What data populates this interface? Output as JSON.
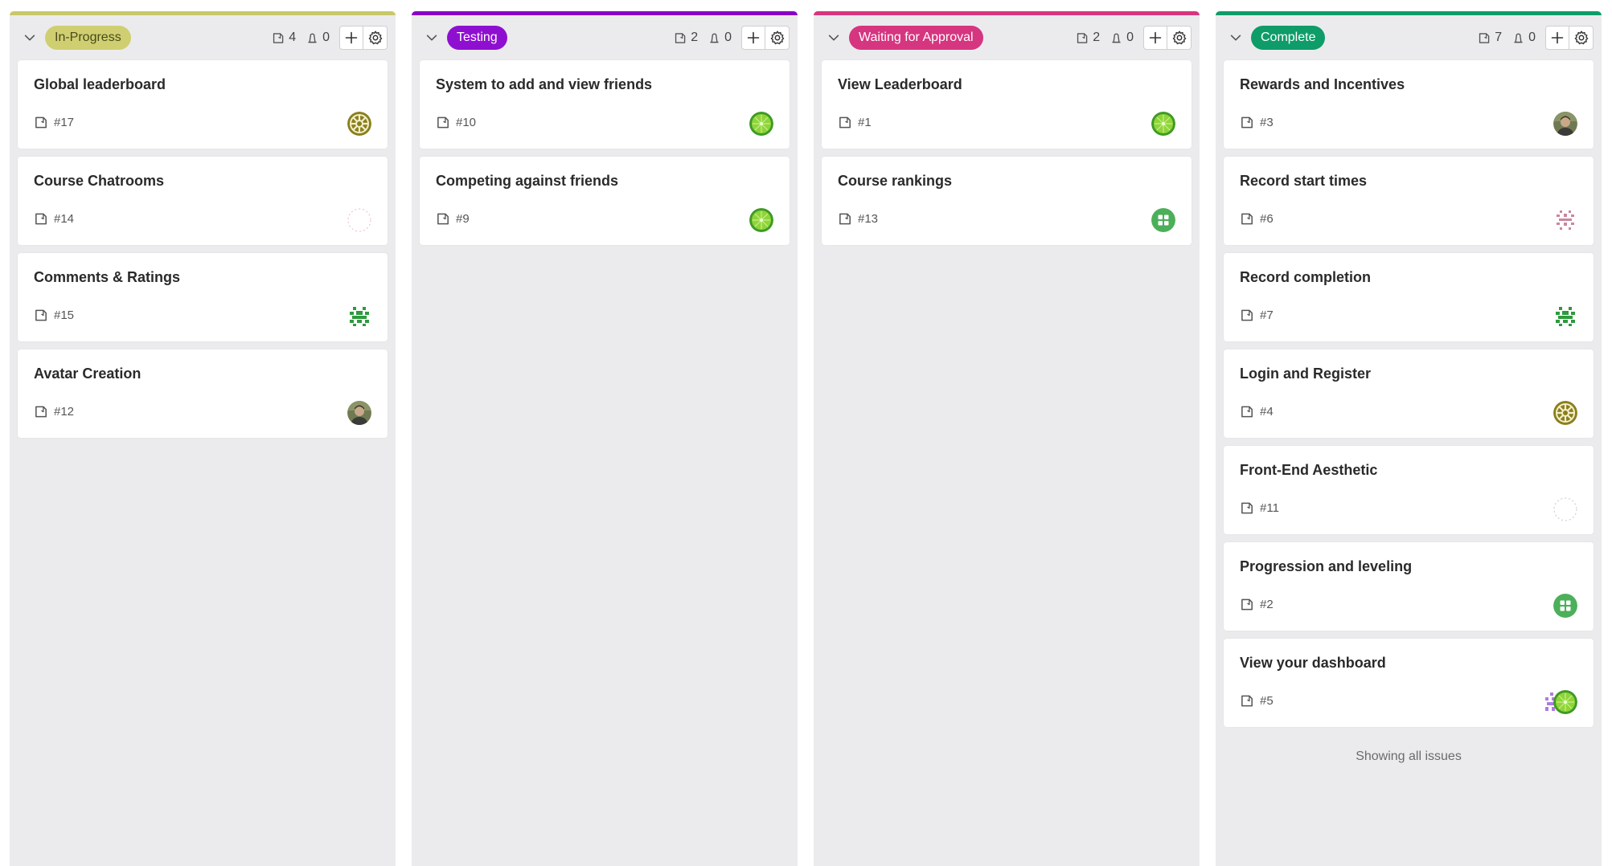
{
  "board": {
    "footer_text": "Showing all issues",
    "columns": [
      {
        "label": "In-Progress",
        "accent": "#c8c86a",
        "pill_bg": "#cfcf72",
        "pill_fg": "#4a4a1a",
        "issue_count": "4",
        "pr_count": "0",
        "cards": [
          {
            "title": "Global leaderboard",
            "number": "#17",
            "avatar": "olive-pattern"
          },
          {
            "title": "Course Chatrooms",
            "number": "#14",
            "avatar": "pink-dotted"
          },
          {
            "title": "Comments & Ratings",
            "number": "#15",
            "avatar": "green-pixel"
          },
          {
            "title": "Avatar Creation",
            "number": "#12",
            "avatar": "photo"
          }
        ]
      },
      {
        "label": "Testing",
        "accent": "#8a00c8",
        "pill_bg": "#8f0fd1",
        "pill_fg": "#ffffff",
        "issue_count": "2",
        "pr_count": "0",
        "cards": [
          {
            "title": "System to add and view friends",
            "number": "#10",
            "avatar": "lime"
          },
          {
            "title": "Competing against friends",
            "number": "#9",
            "avatar": "lime"
          }
        ]
      },
      {
        "label": "Waiting for Approval",
        "accent": "#d6357f",
        "pill_bg": "#d6357f",
        "pill_fg": "#ffffff",
        "issue_count": "2",
        "pr_count": "0",
        "cards": [
          {
            "title": "View Leaderboard",
            "number": "#1",
            "avatar": "lime"
          },
          {
            "title": "Course rankings",
            "number": "#13",
            "avatar": "green-grid"
          }
        ]
      },
      {
        "label": "Complete",
        "accent": "#0e9c68",
        "pill_bg": "#0e9c68",
        "pill_fg": "#ffffff",
        "issue_count": "7",
        "pr_count": "0",
        "cards": [
          {
            "title": "Rewards and Incentives",
            "number": "#3",
            "avatar": "photo"
          },
          {
            "title": "Record start times",
            "number": "#6",
            "avatar": "pink-pixel"
          },
          {
            "title": "Record completion",
            "number": "#7",
            "avatar": "green-pixel"
          },
          {
            "title": "Login and Register",
            "number": "#4",
            "avatar": "olive-pattern"
          },
          {
            "title": "Front-End Aesthetic",
            "number": "#11",
            "avatar": "gray-dotted"
          },
          {
            "title": "Progression and leveling",
            "number": "#2",
            "avatar": "green-grid"
          },
          {
            "title": "View your dashboard",
            "number": "#5",
            "avatar": "stack"
          }
        ]
      }
    ]
  }
}
